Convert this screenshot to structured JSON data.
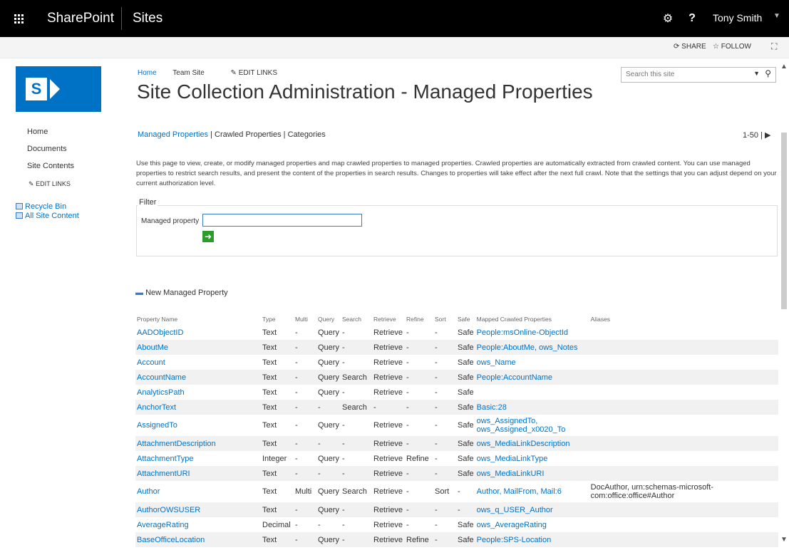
{
  "suite": {
    "brand": "SharePoint",
    "section": "Sites",
    "user": "Tony Smith"
  },
  "actions": {
    "share": "SHARE",
    "follow": "FOLLOW"
  },
  "nav": {
    "items": [
      "Home",
      "Documents",
      "Site Contents"
    ],
    "edit_links": "EDIT LINKS",
    "quick_links": [
      "Recycle Bin",
      "All Site Content"
    ]
  },
  "header": {
    "breadcrumbs": [
      "Home",
      "Team Site"
    ],
    "edit_links": "EDIT LINKS",
    "title": "Site Collection Administration - Managed Properties",
    "search_placeholder": "Search this site"
  },
  "tabs": [
    "Managed Properties",
    "Crawled Properties",
    "Categories"
  ],
  "paging": "1-50 |",
  "description": "Use this page to view, create, or modify managed properties and map crawled properties to managed properties. Crawled properties are automatically extracted from crawled content. You can use managed properties to restrict search results, and present the content of the properties in search results. Changes to properties will take effect after the next full crawl. Note that the settings that you can adjust depend on your current authorization level.",
  "filter": {
    "label": "Filter",
    "field_label": "Managed property",
    "value": ""
  },
  "new_property": "New Managed Property",
  "table": {
    "columns": [
      "Property Name",
      "Type",
      "Multi",
      "Query",
      "Search",
      "Retrieve",
      "Refine",
      "Sort",
      "Safe",
      "Mapped Crawled Properties",
      "Aliases"
    ],
    "rows": [
      [
        "AADObjectID",
        "Text",
        "-",
        "Query",
        "-",
        "Retrieve",
        "-",
        "-",
        "Safe",
        "People:msOnline-ObjectId",
        ""
      ],
      [
        "AboutMe",
        "Text",
        "-",
        "Query",
        "-",
        "Retrieve",
        "-",
        "-",
        "Safe",
        "People:AboutMe, ows_Notes",
        ""
      ],
      [
        "Account",
        "Text",
        "-",
        "Query",
        "-",
        "Retrieve",
        "-",
        "-",
        "Safe",
        "ows_Name",
        ""
      ],
      [
        "AccountName",
        "Text",
        "-",
        "Query",
        "Search",
        "Retrieve",
        "-",
        "-",
        "Safe",
        "People:AccountName",
        ""
      ],
      [
        "AnalyticsPath",
        "Text",
        "-",
        "Query",
        "-",
        "Retrieve",
        "-",
        "-",
        "Safe",
        "",
        ""
      ],
      [
        "AnchorText",
        "Text",
        "-",
        "-",
        "Search",
        "-",
        "-",
        "-",
        "Safe",
        "Basic:28",
        ""
      ],
      [
        "AssignedTo",
        "Text",
        "-",
        "Query",
        "-",
        "Retrieve",
        "-",
        "-",
        "Safe",
        "ows_AssignedTo, ows_Assigned_x0020_To",
        ""
      ],
      [
        "AttachmentDescription",
        "Text",
        "-",
        "-",
        "-",
        "Retrieve",
        "-",
        "-",
        "Safe",
        "ows_MediaLinkDescription",
        ""
      ],
      [
        "AttachmentType",
        "Integer",
        "-",
        "Query",
        "-",
        "Retrieve",
        "Refine",
        "-",
        "Safe",
        "ows_MediaLinkType",
        ""
      ],
      [
        "AttachmentURI",
        "Text",
        "-",
        "-",
        "-",
        "Retrieve",
        "-",
        "-",
        "Safe",
        "ows_MediaLinkURI",
        ""
      ],
      [
        "Author",
        "Text",
        "Multi",
        "Query",
        "Search",
        "Retrieve",
        "-",
        "Sort",
        "-",
        "Author, MailFrom, Mail:6",
        "DocAuthor, urn:schemas-microsoft-com:office:office#Author"
      ],
      [
        "AuthorOWSUSER",
        "Text",
        "-",
        "Query",
        "-",
        "Retrieve",
        "-",
        "-",
        "-",
        "ows_q_USER_Author",
        ""
      ],
      [
        "AverageRating",
        "Decimal",
        "-",
        "-",
        "-",
        "Retrieve",
        "-",
        "-",
        "Safe",
        "ows_AverageRating",
        ""
      ],
      [
        "BaseOfficeLocation",
        "Text",
        "-",
        "Query",
        "-",
        "Retrieve",
        "Refine",
        "-",
        "Safe",
        "People:SPS-Location",
        ""
      ]
    ]
  },
  "icons": {
    "app_launcher": "waffle-icon",
    "settings": "gear-icon",
    "help": "help-icon",
    "share": "sync-icon",
    "follow": "star-icon",
    "focus": "focus-icon",
    "search": "search-icon"
  },
  "colors": {
    "suite_bar": "#000000",
    "accent": "#0072c6",
    "go_button": "#2a9d2a"
  }
}
